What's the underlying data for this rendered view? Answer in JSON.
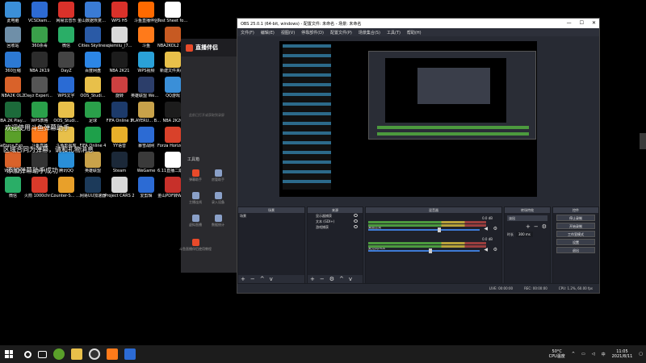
{
  "desktop": {
    "icons": [
      {
        "label": "此电脑",
        "color": "#3b8fd8"
      },
      {
        "label": "VCSDiam...",
        "color": "#2d6bd4"
      },
      {
        "label": "网易云音乐",
        "color": "#d9312a"
      },
      {
        "label": "金山数据恢复大师",
        "color": "#3a7bd5"
      },
      {
        "label": "WPS H5",
        "color": "#d9312a"
      },
      {
        "label": "斗鱼直播伴侣",
        "color": "#ff6a00"
      },
      {
        "label": "Test Sheet for water...",
        "color": "#ffffff"
      },
      {
        "label": "回收站",
        "color": "#6f8fa8"
      },
      {
        "label": "360杀毒",
        "color": "#3aa04a"
      },
      {
        "label": "微信",
        "color": "#2aae67"
      },
      {
        "label": "Cities Skylines",
        "color": "#2a5aa6"
      },
      {
        "label": "qiemilu_(7...",
        "color": "#d9d9d9"
      },
      {
        "label": "斗鱼",
        "color": "#ff7a1a"
      },
      {
        "label": "NBA2KOL2 体验服",
        "color": "#c75a22"
      },
      {
        "label": "360压缩",
        "color": "#2c79d4"
      },
      {
        "label": "NBA 2K19",
        "color": "#2c2c2c"
      },
      {
        "label": "DayZ",
        "color": "#444444"
      },
      {
        "label": "百度网盘",
        "color": "#2c86e6"
      },
      {
        "label": "NBA 2K21",
        "color": "#1c1c1c"
      },
      {
        "label": "WPS视频",
        "color": "#2aa1d8"
      },
      {
        "label": "新建文件夹(2)",
        "color": "#e8c04a"
      },
      {
        "label": "NBA2K OL2",
        "color": "#d9622a"
      },
      {
        "label": "Dayz Experiment",
        "color": "#555555"
      },
      {
        "label": "WPS文字",
        "color": "#2a6bd4"
      },
      {
        "label": "OOS_Studi...",
        "color": "#e8c04a"
      },
      {
        "label": "旋转",
        "color": "#cc4040"
      },
      {
        "label": "英雄联盟 WeGame版",
        "color": "#2c3e6a"
      },
      {
        "label": "QQ游戏",
        "color": "#3a8fd8"
      },
      {
        "label": "NBA 2K Playgroun...",
        "color": "#1c6a3a"
      },
      {
        "label": "WPS表格",
        "color": "#2aa04a"
      },
      {
        "label": "OOS_Studi...",
        "color": "#e8c04a"
      },
      {
        "label": "足球",
        "color": "#2aa04a"
      },
      {
        "label": "FIFA Online 3",
        "color": "#1c3a6a"
      },
      {
        "label": "PLAYERU... BATTLEGR...",
        "color": "#c8a24a"
      },
      {
        "label": "NBA 2K20",
        "color": "#1c1c1c"
      },
      {
        "label": "GeForce Experience",
        "color": "#5aa02a"
      },
      {
        "label": "斗鱼直播",
        "color": "#ff7a1a"
      },
      {
        "label": "斗鱼影视库",
        "color": "#e8c04a"
      },
      {
        "label": "FIFA Online 4",
        "color": "#1ea04a"
      },
      {
        "label": "YY语音",
        "color": "#e8b02a"
      },
      {
        "label": "暴雪战网",
        "color": "#2c6bd4"
      },
      {
        "label": "Forza Horizon 4",
        "color": "#d9412a"
      },
      {
        "label": "WPS演示",
        "color": "#d9622a"
      },
      {
        "label": "obs64",
        "color": "#333333"
      },
      {
        "label": "腾讯QQ",
        "color": "#2a8fd8"
      },
      {
        "label": "英雄联盟",
        "color": "#c8a24a"
      },
      {
        "label": "Steam",
        "color": "#1b2838"
      },
      {
        "label": "WeGame",
        "color": "#3a3a3a"
      },
      {
        "label": "6.11直播二期计划",
        "color": "#ffffff"
      },
      {
        "label": "微信",
        "color": "#2aae67"
      },
      {
        "label": "火箭 1000chro...",
        "color": "#d93a2a"
      },
      {
        "label": "Counter-S... Global Off...",
        "color": "#e8a02a"
      },
      {
        "label": "网易UU加速器",
        "color": "#1c3a5a"
      },
      {
        "label": "Project CARS 2",
        "color": "#d9d9d9"
      },
      {
        "label": "爱剪辑",
        "color": "#2c6bd4"
      },
      {
        "label": "金山PDF转Word",
        "color": "#c7302a"
      }
    ]
  },
  "danmu": {
    "line1": "欢迎使用斗鱼弹幕助手",
    "line2": "区域合同为弹幕，请和礼物消息",
    "line3": "添加弹幕助手成功"
  },
  "helper": {
    "title": "直播伴侣",
    "subtitle": "此前已打开或获取到录屏",
    "tools_title": "工具箱",
    "tools": [
      {
        "label": "弹幕助手",
        "color": "#e84a2a"
      },
      {
        "label": "房管助手",
        "color": "#8aa0c8"
      },
      {
        "label": "主播连线",
        "color": "#8aa0c8"
      },
      {
        "label": "录入设备",
        "color": "#8aa0c8"
      },
      {
        "label": "虚拟直播",
        "color": "#8aa0c8"
      },
      {
        "label": "数据统计",
        "color": "#8aa0c8"
      },
      {
        "label": "斗鱼直播伴侣使用教程",
        "color": "#e84a2a"
      }
    ]
  },
  "obs": {
    "title": "OBS 25.0.1 (64-bit, windows) - 配置文件: 未命名 - 场景: 未命名",
    "menu": [
      "文件(F)",
      "编辑(E)",
      "视图(V)",
      "停靠部件(D)",
      "配置文件(P)",
      "场景集合(S)",
      "工具(T)",
      "帮助(H)"
    ],
    "panels": {
      "scenes": "场景",
      "sources": "来源",
      "mixer": "混音器",
      "transitions": "转场特效",
      "controls": "控件"
    },
    "scene_items": [
      "场景"
    ],
    "source_items": [
      "显示器捕获",
      "文本 (GDI+)",
      "游戏捕获"
    ],
    "mixer_tracks": [
      {
        "name": "桌面音频",
        "db": "0.0 dB",
        "level": 0.62
      },
      {
        "name": "麦克风/Aux",
        "db": "0.0 dB",
        "level": 0.55
      }
    ],
    "transition": {
      "select": "淡出",
      "duration_label": "时长",
      "duration_value": "300 ms"
    },
    "controls": [
      "停止录制",
      "开始录制",
      "工作室模式",
      "设置",
      "退出"
    ],
    "status": {
      "live": "LIVE: 00:00:00",
      "rec": "REC: 00:00:00",
      "cpu": "CPU: 1.2%, 60.00 fps"
    }
  },
  "taskbar": {
    "tray": {
      "temp": "50°C",
      "temp_label": "CPU温度",
      "time": "11:05",
      "date": "2021/8/11"
    }
  }
}
